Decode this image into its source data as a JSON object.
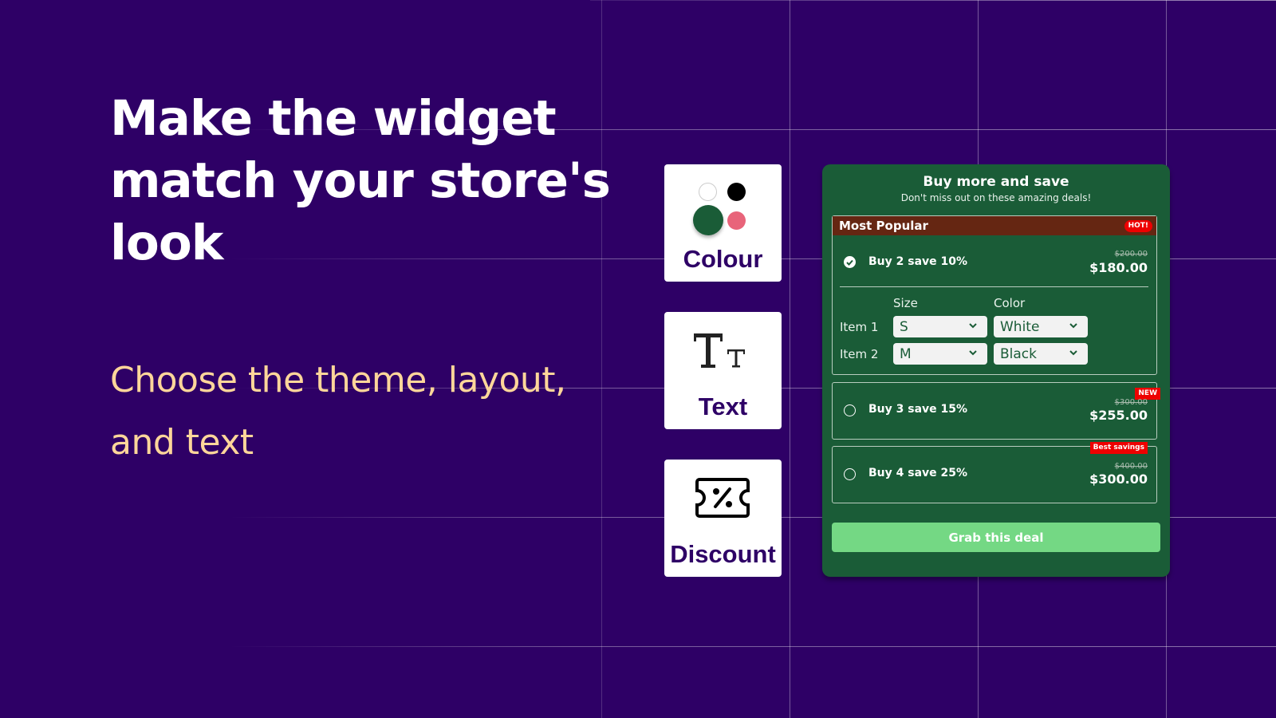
{
  "hero": {
    "headline": "Make the widget match your store's look",
    "subheadline": "Choose the theme, layout, and text"
  },
  "features": [
    {
      "label": "Colour",
      "icon": "color-swatches-icon"
    },
    {
      "label": "Text",
      "icon": "text-size-icon"
    },
    {
      "label": "Discount",
      "icon": "discount-ticket-icon"
    }
  ],
  "swatches": [
    "#ffffff",
    "#000000",
    "#1a5c37",
    "#e8647a"
  ],
  "widget": {
    "title": "Buy more and save",
    "subtitle": "Don't miss out on these amazing deals!",
    "offers": [
      {
        "header": "Most Popular",
        "badge": "HOT!",
        "name": "Buy 2 save 10%",
        "original_price": "$200.00",
        "price": "$180.00",
        "selected": true,
        "variant_headers": [
          "Size",
          "Color"
        ],
        "items": [
          {
            "label": "Item 1",
            "size": "S",
            "color": "White"
          },
          {
            "label": "Item 2",
            "size": "M",
            "color": "Black"
          }
        ]
      },
      {
        "badge": "NEW",
        "name": "Buy 3 save 15%",
        "original_price": "$300.00",
        "price": "$255.00",
        "selected": false
      },
      {
        "badge": "Best savings",
        "name": "Buy 4 save 25%",
        "original_price": "$400.00",
        "price": "$300.00",
        "selected": false
      }
    ],
    "cta_label": "Grab this deal"
  },
  "colors": {
    "background": "#2e0066",
    "widget_bg": "#1a5c37",
    "header_bar": "#652612",
    "badge": "#ee0000",
    "cta": "#74d884",
    "subheadline": "#ffd69a"
  }
}
